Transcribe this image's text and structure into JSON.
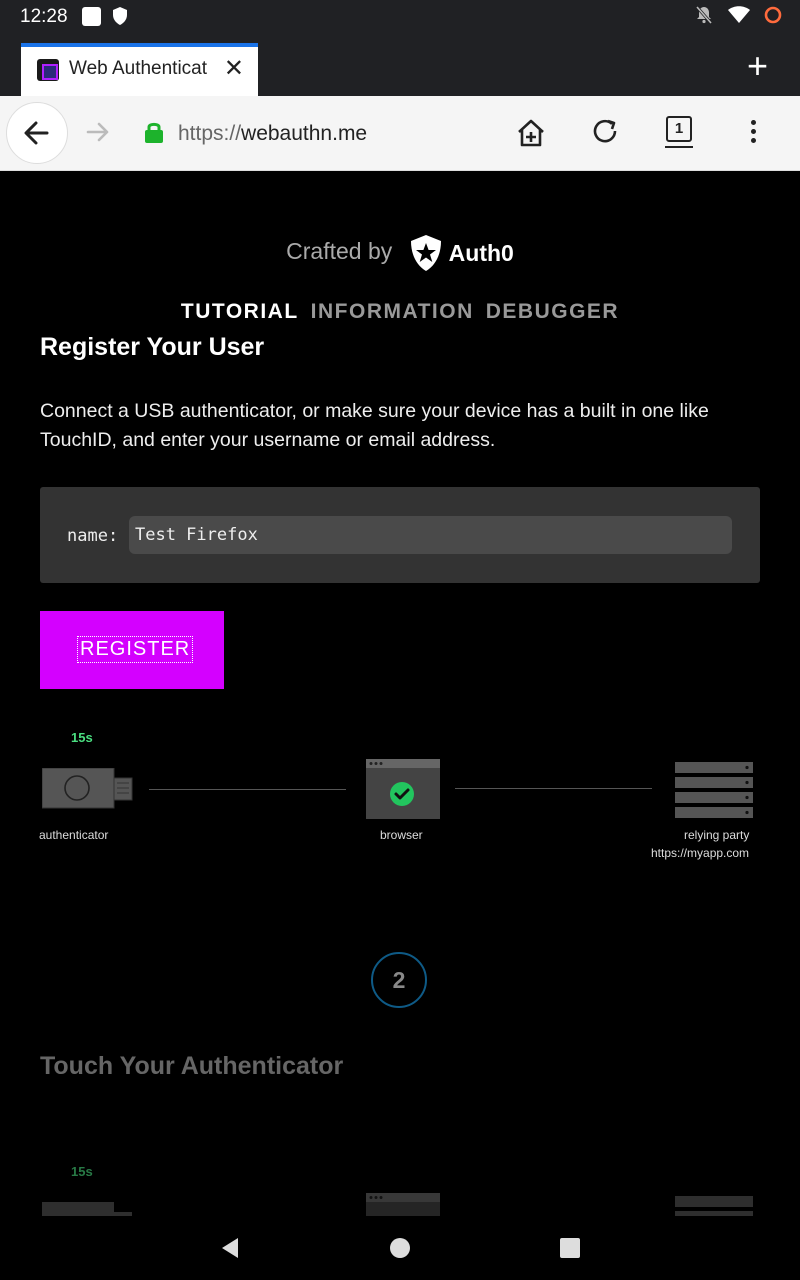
{
  "status_bar": {
    "time": "12:28"
  },
  "tab": {
    "title": "Web Authenticat",
    "close": "✕"
  },
  "new_tab": "+",
  "toolbar": {
    "url_scheme": "https://",
    "url_host": "webauthn.me",
    "tab_count": "1"
  },
  "header": {
    "crafted_by": "Crafted by",
    "brand": "Auth0"
  },
  "nav": {
    "tutorial": "TUTORIAL",
    "information": "INFORMATION",
    "debugger": "DEBUGGER"
  },
  "section1": {
    "heading": "Register Your User",
    "intro": "Connect a USB authenticator, or make sure your device has a built in one like TouchID, and enter your username or email address.",
    "name_label": "name:",
    "name_value": "Test Firefox",
    "register_label": "REGISTER"
  },
  "diagram1": {
    "timer": "15s",
    "authenticator": "authenticator",
    "browser": "browser",
    "relying_party": "relying party",
    "relying_party_url": "https://myapp.com"
  },
  "section2": {
    "step_number": "2",
    "heading": "Touch Your Authenticator"
  },
  "diagram2": {
    "timer": "15s"
  },
  "colors": {
    "accent": "#d400ff",
    "timer": "#4ade80",
    "check": "#22c55e",
    "step_ring": "#0e5a86"
  }
}
